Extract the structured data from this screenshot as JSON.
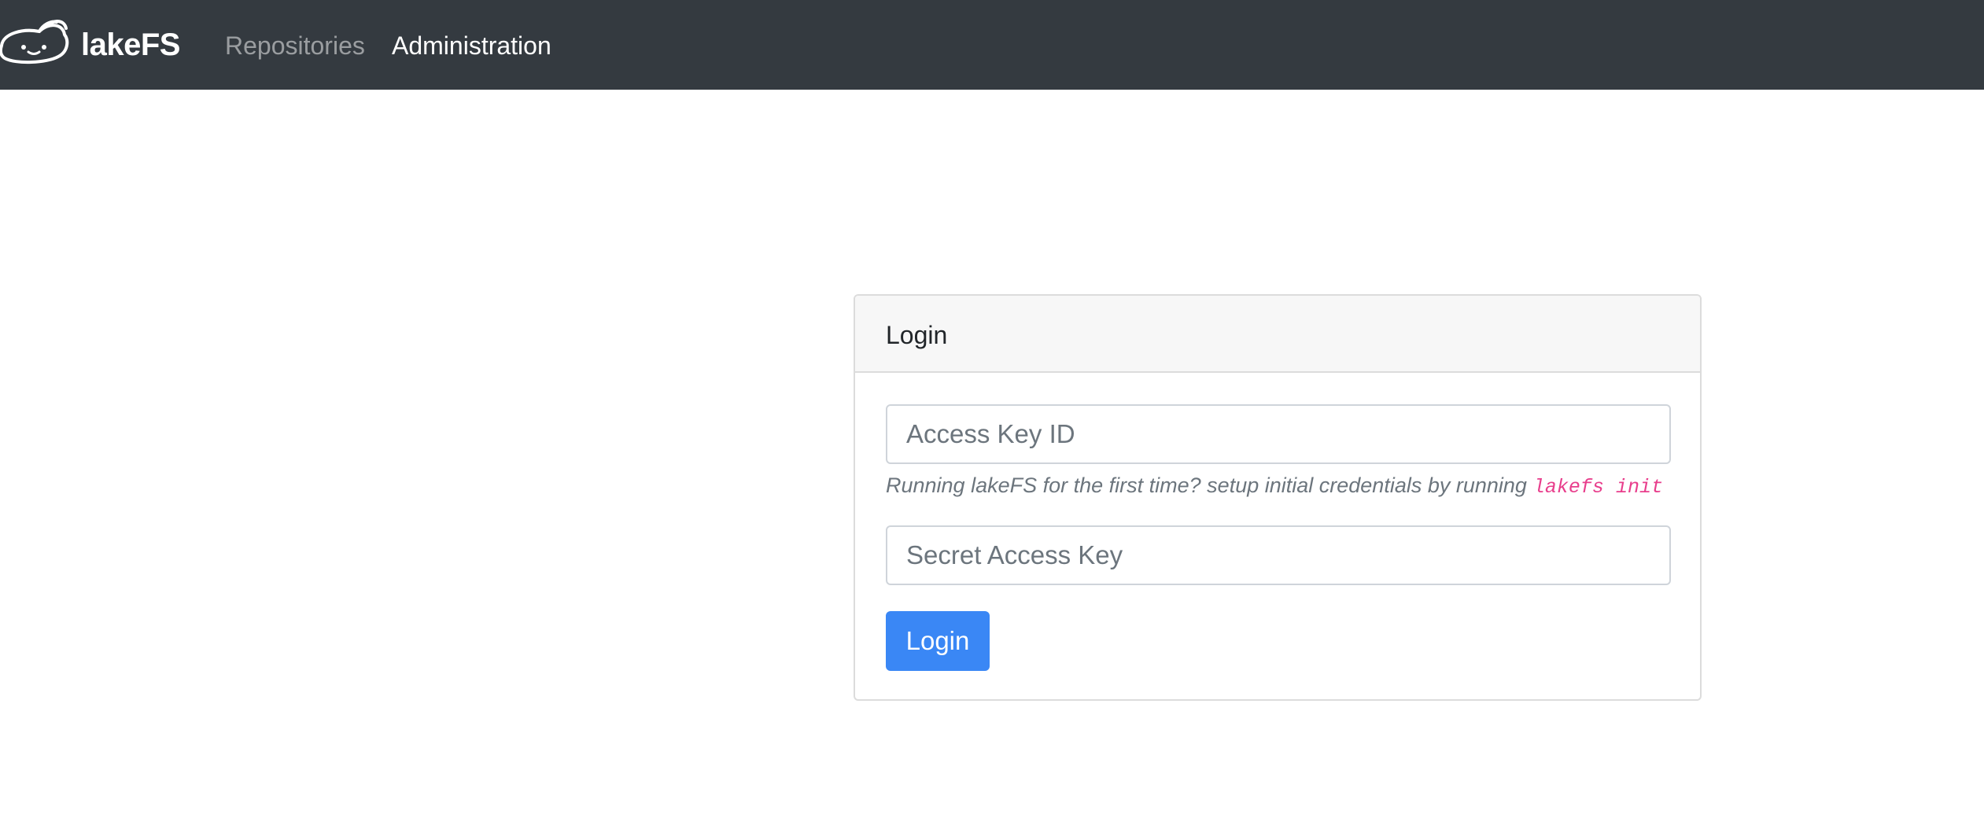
{
  "navbar": {
    "brand": "lakeFS",
    "links": [
      {
        "label": "Repositories"
      },
      {
        "label": "Administration"
      }
    ]
  },
  "login_card": {
    "title": "Login",
    "access_key_placeholder": "Access Key ID",
    "help_text": "Running lakeFS for the first time? setup initial credentials by running",
    "help_command": "lakefs init",
    "secret_key_placeholder": "Secret Access Key",
    "submit_label": "Login"
  },
  "colors": {
    "navbar_bg": "#343a40",
    "primary_button": "#3a87f5",
    "code_text": "#e83e8c"
  },
  "icons": {
    "brand_logo": "lakefs-axolotl-logo-icon"
  }
}
